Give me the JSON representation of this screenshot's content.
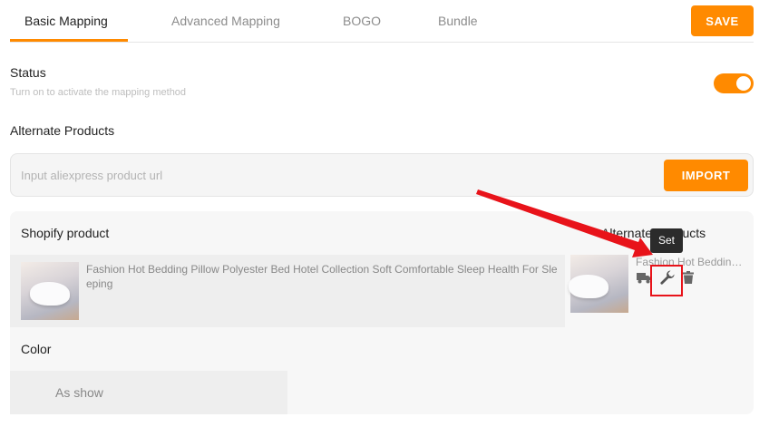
{
  "tabs": [
    {
      "label": "Basic Mapping",
      "active": true
    },
    {
      "label": "Advanced Mapping",
      "active": false
    },
    {
      "label": "BOGO",
      "active": false
    },
    {
      "label": "Bundle",
      "active": false
    }
  ],
  "save_label": "SAVE",
  "status": {
    "label": "Status",
    "hint": "Turn on to activate the mapping method",
    "enabled": true
  },
  "alternate": {
    "label": "Alternate Products",
    "placeholder": "Input aliexpress product url",
    "import_label": "IMPORT"
  },
  "mapping": {
    "shopify_header": "Shopify product",
    "alternate_header": "Alternate Products",
    "shopify_product_title": "Fashion Hot Bedding Pillow Polyester Bed Hotel Collection Soft Comfortable Sleep Health For Sleeping",
    "alternate_product_title": "Fashion Hot Bedding Pillow Polyester Bed Hotel Collection Soft Comfortable Sleep Health For Sleeping",
    "tooltip": "Set",
    "variant_label": "Color",
    "variant_value": "As show"
  },
  "colors": {
    "accent": "#ff8a00",
    "annotation": "#e8131a"
  },
  "icons": [
    "truck-icon",
    "wrench-icon",
    "trash-icon"
  ]
}
